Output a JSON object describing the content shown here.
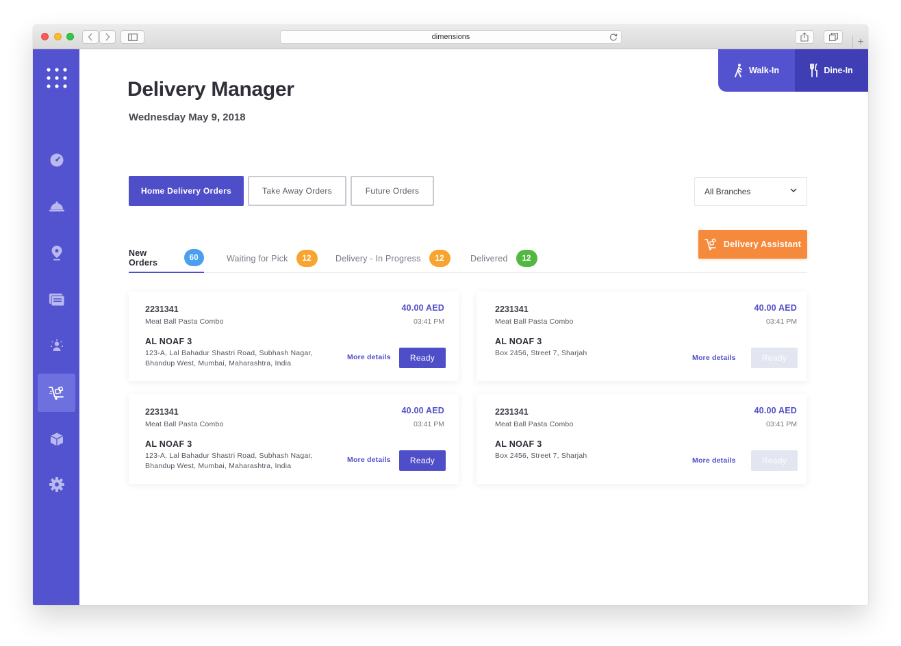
{
  "browser": {
    "url": "dimensions"
  },
  "sidebar": {
    "items": [
      {
        "icon": "apps-grid-icon"
      },
      {
        "icon": "dashboard-gauge-icon"
      },
      {
        "icon": "food-cloche-icon"
      },
      {
        "icon": "location-pin-icon"
      },
      {
        "icon": "orders-list-icon"
      },
      {
        "icon": "staff-icon"
      },
      {
        "icon": "delivery-trolley-icon",
        "active": true
      },
      {
        "icon": "inventory-box-icon"
      },
      {
        "icon": "settings-gear-icon"
      }
    ]
  },
  "header": {
    "title": "Delivery Manager",
    "date": "Wednesday May 9, 2018"
  },
  "mode_toggle": {
    "walk_in": "Walk-In",
    "dine_in": "Dine-In"
  },
  "order_types": {
    "home_delivery": "Home Delivery Orders",
    "take_away": "Take Away Orders",
    "future": "Future Orders"
  },
  "branch_select": {
    "value": "All Branches"
  },
  "delivery_assistant": {
    "label": "Delivery Assistant"
  },
  "status_tabs": [
    {
      "label": "New Orders",
      "count": "60",
      "color": "#4a9ff0"
    },
    {
      "label": "Waiting for Pick",
      "count": "12",
      "color": "#f7a530"
    },
    {
      "label": "Delivery - In Progress",
      "count": "12",
      "color": "#f7a530"
    },
    {
      "label": "Delivered",
      "count": "12",
      "color": "#52b840"
    }
  ],
  "orders": [
    {
      "id": "2231341",
      "item": "Meat Ball Pasta Combo",
      "price": "40.00 AED",
      "time": "03:41 PM",
      "area": "AL NOAF 3",
      "address": "123-A, Lal Bahadur Shastri Road, Subhash Nagar, Bhandup West, Mumbai, Maharashtra, India",
      "more": "More details",
      "ready": "Ready",
      "ready_enabled": true
    },
    {
      "id": "2231341",
      "item": "Meat Ball Pasta Combo",
      "price": "40.00 AED",
      "time": "03:41 PM",
      "area": "AL NOAF 3",
      "address": "Box 2456, Street 7, Sharjah",
      "more": "More details",
      "ready": "Ready",
      "ready_enabled": false
    },
    {
      "id": "2231341",
      "item": "Meat Ball Pasta Combo",
      "price": "40.00 AED",
      "time": "03:41 PM",
      "area": "AL NOAF 3",
      "address": "123-A, Lal Bahadur Shastri Road, Subhash Nagar, Bhandup West, Mumbai, Maharashtra, India",
      "more": "More details",
      "ready": "Ready",
      "ready_enabled": true
    },
    {
      "id": "2231341",
      "item": "Meat Ball Pasta Combo",
      "price": "40.00 AED",
      "time": "03:41 PM",
      "area": "AL NOAF 3",
      "address": "Box 2456, Street 7, Sharjah",
      "more": "More details",
      "ready": "Ready",
      "ready_enabled": false
    }
  ]
}
